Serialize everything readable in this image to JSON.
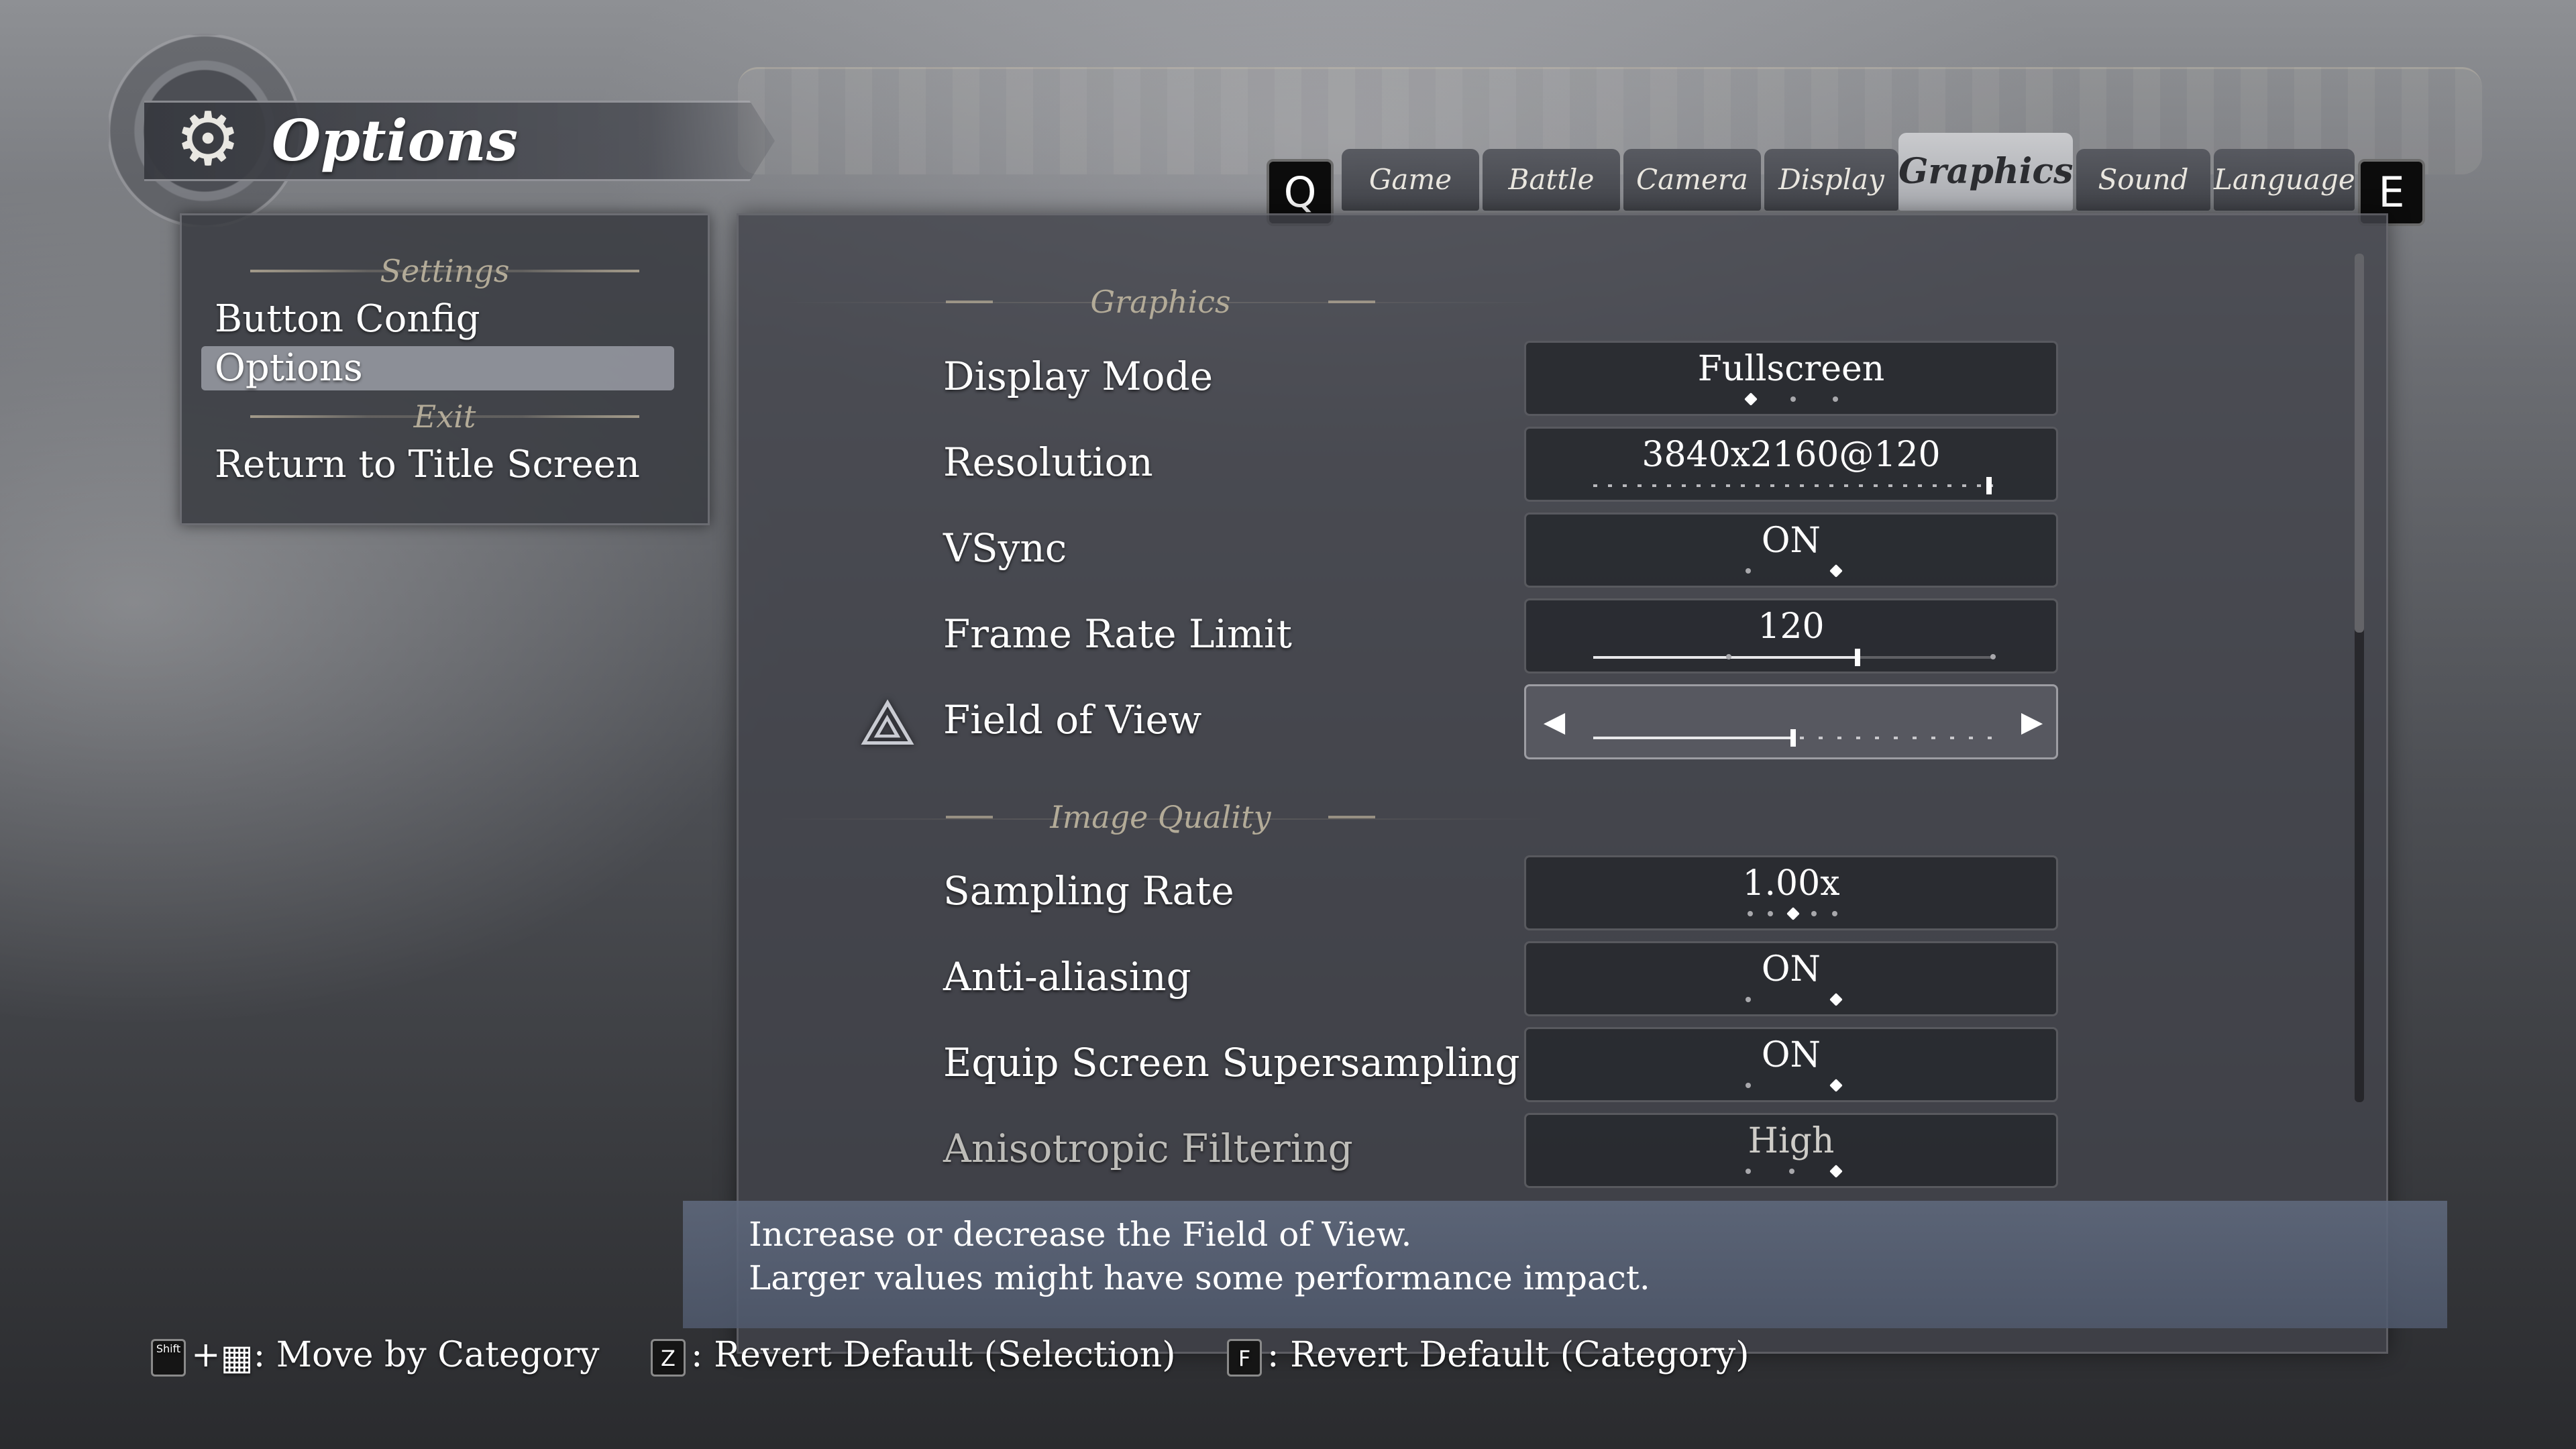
{
  "header": {
    "title": "Options"
  },
  "sidebar": {
    "settings_label": "Settings",
    "items": [
      {
        "label": "Button Config"
      },
      {
        "label": "Options"
      }
    ],
    "exit_label": "Exit",
    "return_label": "Return to Title Screen"
  },
  "tabs": {
    "prev_key": "Q",
    "next_key": "E",
    "items": [
      "Game",
      "Battle",
      "Camera",
      "Display",
      "Graphics",
      "Sound",
      "Language"
    ],
    "active": "Graphics"
  },
  "main": {
    "sections": {
      "graphics": "Graphics",
      "image_quality": "Image Quality"
    },
    "rows": [
      {
        "label": "Display Mode",
        "value": "Fullscreen"
      },
      {
        "label": "Resolution",
        "value": "3840x2160@120"
      },
      {
        "label": "VSync",
        "value": "ON"
      },
      {
        "label": "Frame Rate Limit",
        "value": "120"
      },
      {
        "label": "Field of View",
        "value": ""
      },
      {
        "label": "Sampling Rate",
        "value": "1.00x"
      },
      {
        "label": "Anti-aliasing",
        "value": "ON"
      },
      {
        "label": "Equip Screen Supersampling",
        "value": "ON"
      },
      {
        "label": "Anisotropic Filtering",
        "value": "High"
      }
    ]
  },
  "description": {
    "line1": "Increase or decrease the Field of View.",
    "line2": "Larger values might have some performance impact."
  },
  "footer": {
    "move_by_category": ": Move by Category",
    "revert_selection_key": "Z",
    "revert_selection": ": Revert Default (Selection)",
    "revert_category_key": "F",
    "revert_category": ": Revert Default (Category)",
    "shift_key": "Shift"
  },
  "icons": {
    "gear": "gear-icon",
    "cursor": "triquetra-cursor-icon",
    "left_arrow": "left-arrow-icon",
    "right_arrow": "right-arrow-icon"
  },
  "colors": {
    "accent_text": "#b3ab98",
    "active_tab": "#c9cacd",
    "description_panel": "#5f697d"
  }
}
